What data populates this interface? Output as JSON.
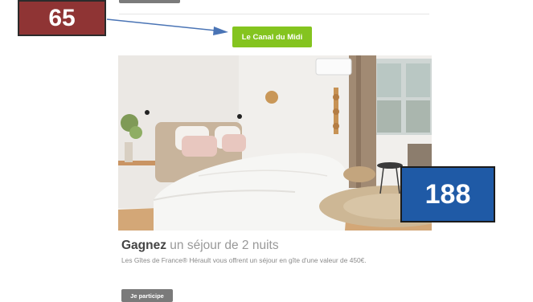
{
  "annotations": {
    "badge_left": "65",
    "badge_right": "188"
  },
  "buttons": {
    "canal": "Le Canal du Midi",
    "participate": "Je participe"
  },
  "contest": {
    "title_bold": "Gagnez",
    "title_rest": " un séjour de 2 nuits",
    "description": "Les Gîtes de France® Hérault vous offrent un séjour en gîte d'une valeur de 450€."
  },
  "colors": {
    "green_button": "#84c41f",
    "grey_button": "#7a7a7a",
    "badge_red": "#8f3434",
    "badge_blue": "#1f5aa6"
  },
  "image": {
    "subject": "bedroom-photo"
  }
}
